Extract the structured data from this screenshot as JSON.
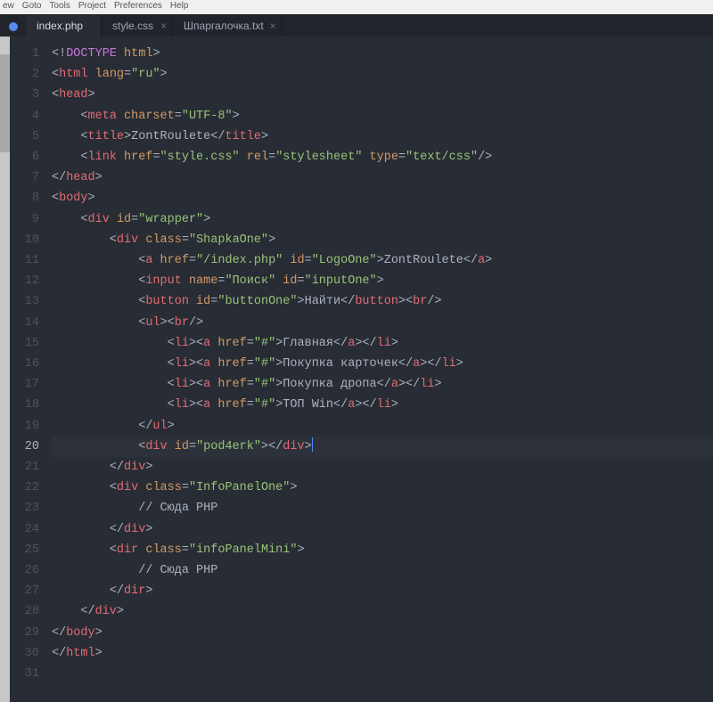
{
  "menubar": [
    "ew",
    "Goto",
    "Tools",
    "Project",
    "Preferences",
    "Help"
  ],
  "tabs": [
    {
      "label": "index.php",
      "active": true,
      "closeable": false
    },
    {
      "label": "style.css",
      "active": false,
      "closeable": true
    },
    {
      "label": "Шпаргалочка.txt",
      "active": false,
      "closeable": true
    }
  ],
  "lines": [
    {
      "n": "1",
      "i": 0,
      "tok": [
        [
          "p",
          "<!"
        ],
        [
          "doct",
          "DOCTYPE"
        ],
        [
          "p",
          " "
        ],
        [
          "a",
          "html"
        ],
        [
          "p",
          ">"
        ]
      ]
    },
    {
      "n": "2",
      "i": 0,
      "tok": [
        [
          "p",
          "<"
        ],
        [
          "t",
          "html"
        ],
        [
          "p",
          " "
        ],
        [
          "a",
          "lang"
        ],
        [
          "p",
          "="
        ],
        [
          "s",
          "\"ru\""
        ],
        [
          "p",
          ">"
        ]
      ]
    },
    {
      "n": "3",
      "i": 0,
      "tok": [
        [
          "p",
          "<"
        ],
        [
          "t",
          "head"
        ],
        [
          "p",
          ">"
        ]
      ]
    },
    {
      "n": "4",
      "i": 1,
      "tok": [
        [
          "p",
          "<"
        ],
        [
          "t",
          "meta"
        ],
        [
          "p",
          " "
        ],
        [
          "a",
          "charset"
        ],
        [
          "p",
          "="
        ],
        [
          "s",
          "\"UTF-8\""
        ],
        [
          "p",
          ">"
        ]
      ]
    },
    {
      "n": "5",
      "i": 1,
      "tok": [
        [
          "p",
          "<"
        ],
        [
          "t",
          "title"
        ],
        [
          "p",
          ">"
        ],
        [
          "txt",
          "ZontRoulete"
        ],
        [
          "p",
          "</"
        ],
        [
          "t",
          "title"
        ],
        [
          "p",
          ">"
        ]
      ]
    },
    {
      "n": "6",
      "i": 1,
      "tok": [
        [
          "p",
          "<"
        ],
        [
          "t",
          "link"
        ],
        [
          "p",
          " "
        ],
        [
          "a",
          "href"
        ],
        [
          "p",
          "="
        ],
        [
          "s",
          "\"style.css\""
        ],
        [
          "p",
          " "
        ],
        [
          "a",
          "rel"
        ],
        [
          "p",
          "="
        ],
        [
          "s",
          "\"stylesheet\""
        ],
        [
          "p",
          " "
        ],
        [
          "a",
          "type"
        ],
        [
          "p",
          "="
        ],
        [
          "s",
          "\"text/css\""
        ],
        [
          "p",
          "/>"
        ]
      ]
    },
    {
      "n": "7",
      "i": 0,
      "tok": [
        [
          "p",
          "</"
        ],
        [
          "t",
          "head"
        ],
        [
          "p",
          ">"
        ]
      ]
    },
    {
      "n": "8",
      "i": 0,
      "tok": [
        [
          "p",
          "<"
        ],
        [
          "t",
          "body"
        ],
        [
          "p",
          ">"
        ]
      ]
    },
    {
      "n": "9",
      "i": 1,
      "tok": [
        [
          "p",
          "<"
        ],
        [
          "t",
          "div"
        ],
        [
          "p",
          " "
        ],
        [
          "a",
          "id"
        ],
        [
          "p",
          "="
        ],
        [
          "s",
          "\"wrapper\""
        ],
        [
          "p",
          ">"
        ]
      ]
    },
    {
      "n": "10",
      "i": 2,
      "tok": [
        [
          "p",
          "<"
        ],
        [
          "t",
          "div"
        ],
        [
          "p",
          " "
        ],
        [
          "a",
          "class"
        ],
        [
          "p",
          "="
        ],
        [
          "s",
          "\"ShapkaOne\""
        ],
        [
          "p",
          ">"
        ]
      ]
    },
    {
      "n": "11",
      "i": 3,
      "tok": [
        [
          "p",
          "<"
        ],
        [
          "t",
          "a"
        ],
        [
          "p",
          " "
        ],
        [
          "a",
          "href"
        ],
        [
          "p",
          "="
        ],
        [
          "s",
          "\"/index.php\""
        ],
        [
          "p",
          " "
        ],
        [
          "a",
          "id"
        ],
        [
          "p",
          "="
        ],
        [
          "s",
          "\"LogoOne\""
        ],
        [
          "p",
          ">"
        ],
        [
          "txt",
          "ZontRoulete"
        ],
        [
          "p",
          "</"
        ],
        [
          "t",
          "a"
        ],
        [
          "p",
          ">"
        ]
      ]
    },
    {
      "n": "12",
      "i": 3,
      "tok": [
        [
          "p",
          "<"
        ],
        [
          "t",
          "input"
        ],
        [
          "p",
          " "
        ],
        [
          "a",
          "name"
        ],
        [
          "p",
          "="
        ],
        [
          "s",
          "\"Поиск\""
        ],
        [
          "p",
          " "
        ],
        [
          "a",
          "id"
        ],
        [
          "p",
          "="
        ],
        [
          "s",
          "\"inputOne\""
        ],
        [
          "p",
          ">"
        ]
      ]
    },
    {
      "n": "13",
      "i": 3,
      "tok": [
        [
          "p",
          "<"
        ],
        [
          "t",
          "button"
        ],
        [
          "p",
          " "
        ],
        [
          "a",
          "id"
        ],
        [
          "p",
          "="
        ],
        [
          "s",
          "\"buttonOne\""
        ],
        [
          "p",
          ">"
        ],
        [
          "txt",
          "Найти"
        ],
        [
          "p",
          "</"
        ],
        [
          "t",
          "button"
        ],
        [
          "p",
          "><"
        ],
        [
          "t",
          "br"
        ],
        [
          "p",
          "/>"
        ]
      ]
    },
    {
      "n": "14",
      "i": 3,
      "tok": [
        [
          "p",
          "<"
        ],
        [
          "t",
          "ul"
        ],
        [
          "p",
          "><"
        ],
        [
          "t",
          "br"
        ],
        [
          "p",
          "/>"
        ]
      ]
    },
    {
      "n": "15",
      "i": 4,
      "tok": [
        [
          "p",
          "<"
        ],
        [
          "t",
          "li"
        ],
        [
          "p",
          "><"
        ],
        [
          "t",
          "a"
        ],
        [
          "p",
          " "
        ],
        [
          "a",
          "href"
        ],
        [
          "p",
          "="
        ],
        [
          "s",
          "\"#\""
        ],
        [
          "p",
          ">"
        ],
        [
          "txt",
          "Главная"
        ],
        [
          "p",
          "</"
        ],
        [
          "t",
          "a"
        ],
        [
          "p",
          "></"
        ],
        [
          "t",
          "li"
        ],
        [
          "p",
          ">"
        ]
      ]
    },
    {
      "n": "16",
      "i": 4,
      "tok": [
        [
          "p",
          "<"
        ],
        [
          "t",
          "li"
        ],
        [
          "p",
          "><"
        ],
        [
          "t",
          "a"
        ],
        [
          "p",
          " "
        ],
        [
          "a",
          "href"
        ],
        [
          "p",
          "="
        ],
        [
          "s",
          "\"#\""
        ],
        [
          "p",
          ">"
        ],
        [
          "txt",
          "Покупка карточек"
        ],
        [
          "p",
          "</"
        ],
        [
          "t",
          "a"
        ],
        [
          "p",
          "></"
        ],
        [
          "t",
          "li"
        ],
        [
          "p",
          ">"
        ]
      ]
    },
    {
      "n": "17",
      "i": 4,
      "tok": [
        [
          "p",
          "<"
        ],
        [
          "t",
          "li"
        ],
        [
          "p",
          "><"
        ],
        [
          "t",
          "a"
        ],
        [
          "p",
          " "
        ],
        [
          "a",
          "href"
        ],
        [
          "p",
          "="
        ],
        [
          "s",
          "\"#\""
        ],
        [
          "p",
          ">"
        ],
        [
          "txt",
          "Покупка дропа"
        ],
        [
          "p",
          "</"
        ],
        [
          "t",
          "a"
        ],
        [
          "p",
          "></"
        ],
        [
          "t",
          "li"
        ],
        [
          "p",
          ">"
        ]
      ]
    },
    {
      "n": "18",
      "i": 4,
      "tok": [
        [
          "p",
          "<"
        ],
        [
          "t",
          "li"
        ],
        [
          "p",
          "><"
        ],
        [
          "t",
          "a"
        ],
        [
          "p",
          " "
        ],
        [
          "a",
          "href"
        ],
        [
          "p",
          "="
        ],
        [
          "s",
          "\"#\""
        ],
        [
          "p",
          ">"
        ],
        [
          "txt",
          "ТОП Win"
        ],
        [
          "p",
          "</"
        ],
        [
          "t",
          "a"
        ],
        [
          "p",
          "></"
        ],
        [
          "t",
          "li"
        ],
        [
          "p",
          ">"
        ]
      ]
    },
    {
      "n": "19",
      "i": 3,
      "tok": [
        [
          "p",
          "</"
        ],
        [
          "t",
          "ul"
        ],
        [
          "p",
          ">"
        ]
      ]
    },
    {
      "n": "20",
      "i": 3,
      "cur": true,
      "tok": [
        [
          "p",
          "<"
        ],
        [
          "t",
          "div"
        ],
        [
          "p",
          " "
        ],
        [
          "a",
          "id"
        ],
        [
          "p",
          "="
        ],
        [
          "s",
          "\"pod4erk\""
        ],
        [
          "p",
          "></"
        ],
        [
          "t",
          "div"
        ],
        [
          "p",
          ">"
        ],
        [
          "cursor",
          ""
        ]
      ]
    },
    {
      "n": "21",
      "i": 2,
      "tok": [
        [
          "p",
          "</"
        ],
        [
          "t",
          "div"
        ],
        [
          "p",
          ">"
        ]
      ]
    },
    {
      "n": "22",
      "i": 2,
      "tok": [
        [
          "p",
          "<"
        ],
        [
          "t",
          "div"
        ],
        [
          "p",
          " "
        ],
        [
          "a",
          "class"
        ],
        [
          "p",
          "="
        ],
        [
          "s",
          "\"InfoPanelOne\""
        ],
        [
          "p",
          ">"
        ]
      ]
    },
    {
      "n": "23",
      "i": 3,
      "tok": [
        [
          "txt",
          "// Сюда PHP"
        ]
      ]
    },
    {
      "n": "24",
      "i": 2,
      "tok": [
        [
          "p",
          "</"
        ],
        [
          "t",
          "div"
        ],
        [
          "p",
          ">"
        ]
      ]
    },
    {
      "n": "25",
      "i": 2,
      "tok": [
        [
          "p",
          "<"
        ],
        [
          "t",
          "dir"
        ],
        [
          "p",
          " "
        ],
        [
          "a",
          "class"
        ],
        [
          "p",
          "="
        ],
        [
          "s",
          "\"infoPanelMini\""
        ],
        [
          "p",
          ">"
        ]
      ]
    },
    {
      "n": "26",
      "i": 3,
      "tok": [
        [
          "txt",
          "// Сюда PHP"
        ]
      ]
    },
    {
      "n": "27",
      "i": 2,
      "tok": [
        [
          "p",
          "</"
        ],
        [
          "t",
          "dir"
        ],
        [
          "p",
          ">"
        ]
      ]
    },
    {
      "n": "28",
      "i": 1,
      "tok": [
        [
          "p",
          "</"
        ],
        [
          "t",
          "div"
        ],
        [
          "p",
          ">"
        ]
      ]
    },
    {
      "n": "29",
      "i": 0,
      "tok": [
        [
          "p",
          "</"
        ],
        [
          "t",
          "body"
        ],
        [
          "p",
          ">"
        ]
      ]
    },
    {
      "n": "30",
      "i": 0,
      "tok": [
        [
          "p",
          "</"
        ],
        [
          "t",
          "html"
        ],
        [
          "p",
          ">"
        ]
      ]
    },
    {
      "n": "31",
      "i": 0,
      "tok": []
    }
  ]
}
